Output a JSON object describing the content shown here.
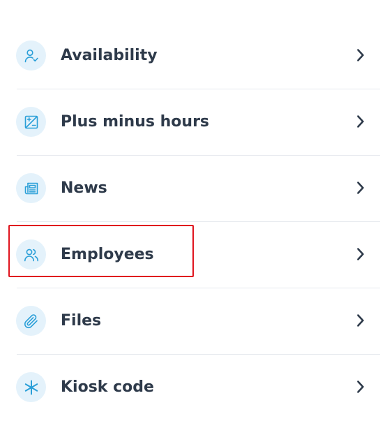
{
  "menu": {
    "items": [
      {
        "label": "Availability",
        "icon": "person-check-icon"
      },
      {
        "label": "Plus minus hours",
        "icon": "plus-minus-icon"
      },
      {
        "label": "News",
        "icon": "newspaper-icon"
      },
      {
        "label": "Employees",
        "icon": "people-icon"
      },
      {
        "label": "Files",
        "icon": "paperclip-icon"
      },
      {
        "label": "Kiosk code",
        "icon": "asterisk-icon"
      }
    ]
  },
  "highlighted_item": "Employees",
  "colors": {
    "accent": "#2a9fd8",
    "icon_background": "#e4f2fb",
    "label": "#2e3a4a",
    "highlight": "#e0141e",
    "divider": "#e6e9ee"
  }
}
